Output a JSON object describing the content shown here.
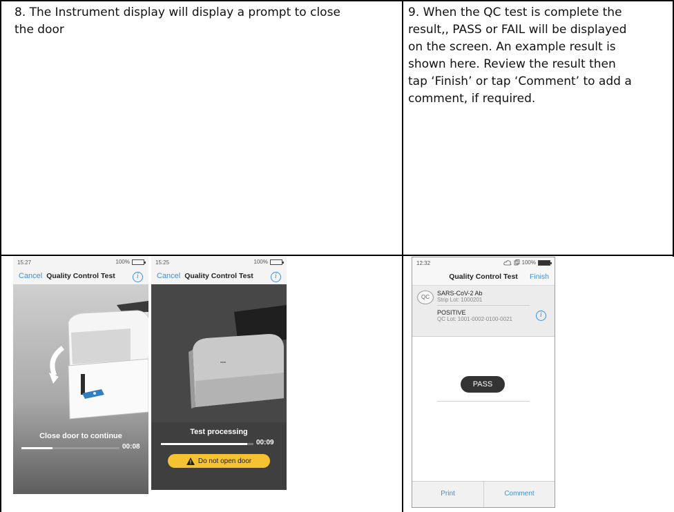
{
  "steps": {
    "step8": {
      "text_line1": "8. The Instrument display will display a prompt to close",
      "text_line2": "the door"
    },
    "step9": {
      "lines": [
        "9. When the QC test is complete the",
        "result,, PASS or FAIL will be displayed",
        "on the screen. An example result is",
        "shown here. Review the result then",
        "tap ‘Finish’ or tap ‘Comment’ to add a",
        "comment, if required."
      ]
    }
  },
  "screen_close_door": {
    "time": "15:27",
    "battery": "100%",
    "cancel": "Cancel",
    "title": "Quality Control Test",
    "prompt": "Close door to continue",
    "timer": "00:08",
    "progress_fraction": 0.32
  },
  "screen_processing": {
    "time": "15:25",
    "battery": "100%",
    "cancel": "Cancel",
    "title": "Quality Control Test",
    "prompt": "Test processing",
    "timer": "00:09",
    "warning": "Do not open door",
    "progress_fraction": 0.93,
    "accent": "#f5c232"
  },
  "screen_result": {
    "time": "12:32",
    "battery": "100%",
    "title": "Quality Control Test",
    "finish": "Finish",
    "qc_badge": "QC",
    "assay_name": "SARS-CoV-2 Ab",
    "strip_lot": "Strip Lot: 1000201",
    "control_level": "POSITIVE",
    "qc_lot": "QC Lot: 1001-0002-0100-0021",
    "result": "PASS",
    "print": "Print",
    "comment": "Comment",
    "accent": "#3d8fd6"
  }
}
